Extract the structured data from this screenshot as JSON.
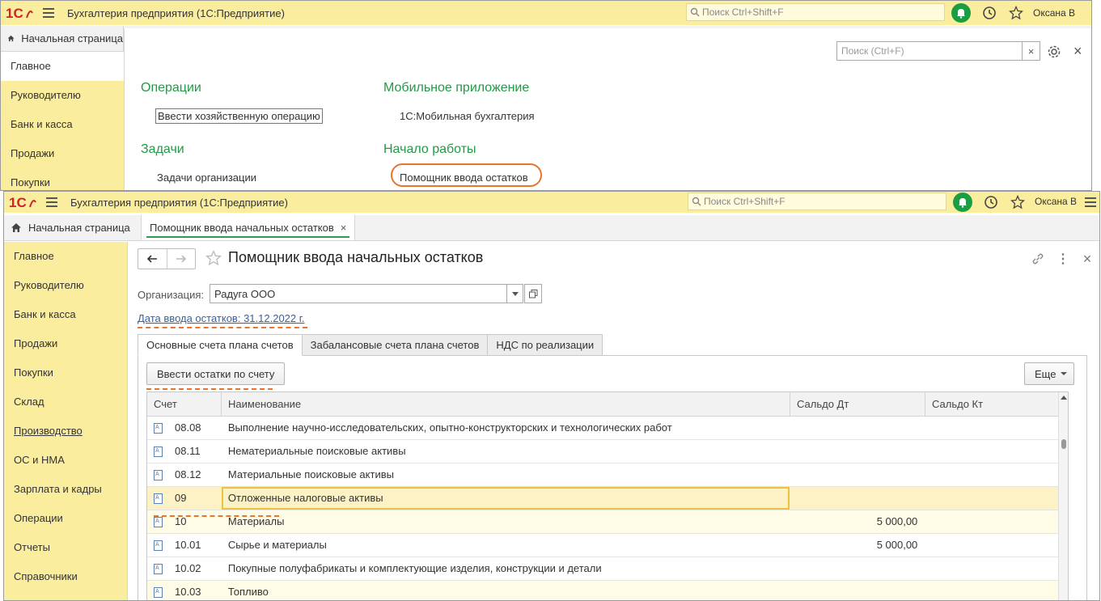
{
  "app": {
    "title": "Бухгалтерия предприятия  (1С:Предприятие)",
    "search_placeholder": "Поиск Ctrl+Shift+F",
    "user": "Оксана В",
    "home_tab": "Начальная страница"
  },
  "back_window": {
    "sidebar": [
      "Главное",
      "Руководителю",
      "Банк и касса",
      "Продажи",
      "Покупки"
    ],
    "search_placeholder": "Поиск (Ctrl+F)",
    "sections": {
      "operations_title": "Операции",
      "operations_link": "Ввести хозяйственную операцию",
      "tasks_title": "Задачи",
      "tasks_link": "Задачи организации",
      "mobile_title": "Мобильное приложение",
      "mobile_link": "1С:Мобильная бухгалтерия",
      "start_title": "Начало работы",
      "start_link": "Помощник ввода остатков"
    }
  },
  "front_window": {
    "open_tab": "Помощник ввода начальных остатков",
    "sidebar": [
      "Главное",
      "Руководителю",
      "Банк и касса",
      "Продажи",
      "Покупки",
      "Склад",
      "Производство",
      "ОС и НМА",
      "Зарплата и кадры",
      "Операции",
      "Отчеты",
      "Справочники"
    ],
    "form_title": "Помощник ввода начальных остатков",
    "org_label": "Организация:",
    "org_value": "Радуга ООО",
    "date_link": "Дата ввода остатков: 31.12.2022 г.",
    "tabs": [
      "Основные счета плана счетов",
      "Забалансовые счета плана счетов",
      "НДС по реализации"
    ],
    "enter_button": "Ввести остатки по счету",
    "more_button": "Еще",
    "columns": [
      "Счет",
      "Наименование",
      "Сальдо Дт",
      "Сальдо Кт"
    ],
    "rows": [
      {
        "account": "08.08",
        "name": "Выполнение научно-исследовательских, опытно-конструкторских и технологических работ",
        "dt": "",
        "kt": ""
      },
      {
        "account": "08.11",
        "name": "Нематериальные поисковые активы",
        "dt": "",
        "kt": ""
      },
      {
        "account": "08.12",
        "name": "Материальные поисковые активы",
        "dt": "",
        "kt": ""
      },
      {
        "account": "09",
        "name": "Отложенные налоговые активы",
        "dt": "",
        "kt": ""
      },
      {
        "account": "10",
        "name": "Материалы",
        "dt": "5 000,00",
        "kt": ""
      },
      {
        "account": "10.01",
        "name": "Сырье и материалы",
        "dt": "5 000,00",
        "kt": ""
      },
      {
        "account": "10.02",
        "name": "Покупные полуфабрикаты и комплектующие изделия, конструкции и детали",
        "dt": "",
        "kt": ""
      },
      {
        "account": "10.03",
        "name": "Топливо",
        "dt": "",
        "kt": ""
      }
    ]
  },
  "colors": {
    "titlebar": "#fbed9e",
    "section_green": "#229945",
    "highlight_orange": "#e7752a",
    "selected_row": "#fcf2c6"
  }
}
